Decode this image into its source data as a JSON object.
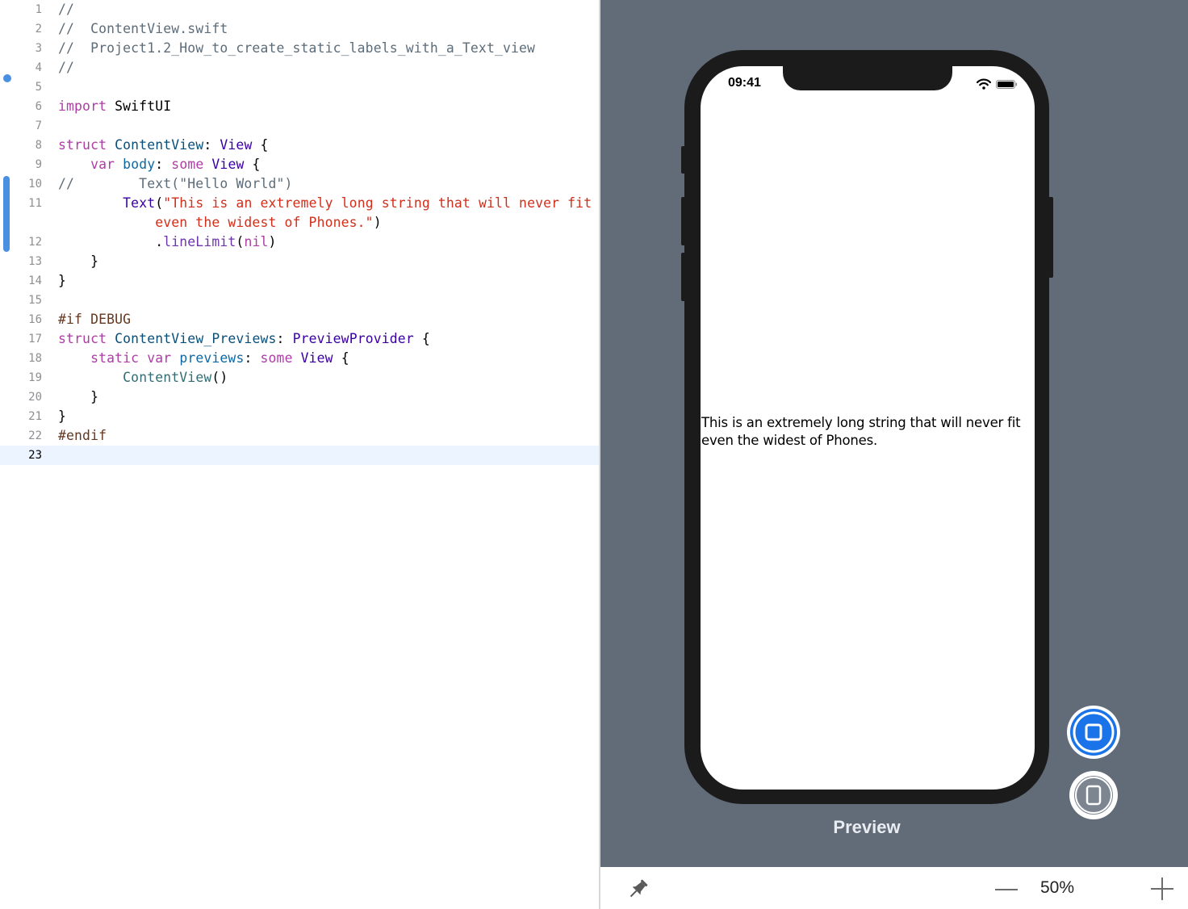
{
  "editor": {
    "current_line": 23,
    "lines": [
      {
        "n": "1",
        "tokens": [
          {
            "c": "comment",
            "t": "//"
          }
        ]
      },
      {
        "n": "2",
        "tokens": [
          {
            "c": "comment",
            "t": "//  ContentView.swift"
          }
        ]
      },
      {
        "n": "3",
        "tokens": [
          {
            "c": "comment",
            "t": "//  Project1.2_How_to_create_static_labels_with_a_Text_view"
          }
        ]
      },
      {
        "n": "4",
        "tokens": [
          {
            "c": "comment",
            "t": "//"
          }
        ]
      },
      {
        "n": "5",
        "tokens": []
      },
      {
        "n": "6",
        "tokens": [
          {
            "c": "kw",
            "t": "import"
          },
          {
            "c": "plain",
            "t": " SwiftUI"
          }
        ]
      },
      {
        "n": "7",
        "tokens": []
      },
      {
        "n": "8",
        "tokens": [
          {
            "c": "kw",
            "t": "struct"
          },
          {
            "c": "plain",
            "t": " "
          },
          {
            "c": "type",
            "t": "ContentView"
          },
          {
            "c": "plain",
            "t": ": "
          },
          {
            "c": "sys",
            "t": "View"
          },
          {
            "c": "plain",
            "t": " {"
          }
        ]
      },
      {
        "n": "9",
        "tokens": [
          {
            "c": "plain",
            "t": "    "
          },
          {
            "c": "kw",
            "t": "var"
          },
          {
            "c": "plain",
            "t": " "
          },
          {
            "c": "prop",
            "t": "body"
          },
          {
            "c": "plain",
            "t": ": "
          },
          {
            "c": "kw",
            "t": "some"
          },
          {
            "c": "plain",
            "t": " "
          },
          {
            "c": "sys",
            "t": "View"
          },
          {
            "c": "plain",
            "t": " {"
          }
        ]
      },
      {
        "n": "10",
        "tokens": [
          {
            "c": "comment",
            "t": "//        Text(\"Hello World\")"
          }
        ]
      },
      {
        "n": "11",
        "tokens": [
          {
            "c": "plain",
            "t": "        "
          },
          {
            "c": "sys",
            "t": "Text"
          },
          {
            "c": "plain",
            "t": "("
          },
          {
            "c": "str",
            "t": "\"This is an extremely long string that will never fit"
          }
        ]
      },
      {
        "n": "",
        "tokens": [
          {
            "c": "str",
            "t": "            even the widest of Phones.\""
          },
          {
            "c": "plain",
            "t": ")"
          }
        ]
      },
      {
        "n": "12",
        "tokens": [
          {
            "c": "plain",
            "t": "            ."
          },
          {
            "c": "meth",
            "t": "lineLimit"
          },
          {
            "c": "plain",
            "t": "("
          },
          {
            "c": "kw",
            "t": "nil"
          },
          {
            "c": "plain",
            "t": ")"
          }
        ]
      },
      {
        "n": "13",
        "tokens": [
          {
            "c": "plain",
            "t": "    }"
          }
        ]
      },
      {
        "n": "14",
        "tokens": [
          {
            "c": "plain",
            "t": "}"
          }
        ]
      },
      {
        "n": "15",
        "tokens": []
      },
      {
        "n": "16",
        "tokens": [
          {
            "c": "pre",
            "t": "#if DEBUG"
          }
        ]
      },
      {
        "n": "17",
        "tokens": [
          {
            "c": "kw",
            "t": "struct"
          },
          {
            "c": "plain",
            "t": " "
          },
          {
            "c": "type",
            "t": "ContentView_Previews"
          },
          {
            "c": "plain",
            "t": ": "
          },
          {
            "c": "sys",
            "t": "PreviewProvider"
          },
          {
            "c": "plain",
            "t": " {"
          }
        ]
      },
      {
        "n": "18",
        "tokens": [
          {
            "c": "plain",
            "t": "    "
          },
          {
            "c": "kw",
            "t": "static"
          },
          {
            "c": "plain",
            "t": " "
          },
          {
            "c": "kw",
            "t": "var"
          },
          {
            "c": "plain",
            "t": " "
          },
          {
            "c": "prop",
            "t": "previews"
          },
          {
            "c": "plain",
            "t": ": "
          },
          {
            "c": "kw",
            "t": "some"
          },
          {
            "c": "plain",
            "t": " "
          },
          {
            "c": "sys",
            "t": "View"
          },
          {
            "c": "plain",
            "t": " {"
          }
        ]
      },
      {
        "n": "19",
        "tokens": [
          {
            "c": "plain",
            "t": "        "
          },
          {
            "c": "call",
            "t": "ContentView"
          },
          {
            "c": "plain",
            "t": "()"
          }
        ]
      },
      {
        "n": "20",
        "tokens": [
          {
            "c": "plain",
            "t": "    }"
          }
        ]
      },
      {
        "n": "21",
        "tokens": [
          {
            "c": "plain",
            "t": "}"
          }
        ]
      },
      {
        "n": "22",
        "tokens": [
          {
            "c": "pre",
            "t": "#endif"
          }
        ]
      },
      {
        "n": "23",
        "tokens": []
      }
    ]
  },
  "preview": {
    "status_time": "09:41",
    "text": "This is an extremely long string that will never fit even the widest of Phones.",
    "label": "Preview"
  },
  "toolbar": {
    "zoom": "50%"
  },
  "icons": {
    "pin": "pin-icon",
    "live": "live-preview-icon",
    "device": "device-icon",
    "wifi": "wifi-icon",
    "battery": "battery-icon",
    "zoom_out": "minus-icon",
    "zoom_in": "plus-icon"
  },
  "colors": {
    "canvas": "#626b78",
    "phone_bezel": "#1b1b1c",
    "live_button": "#1a73e8",
    "current_line": "#ecf5ff",
    "change_marker": "#4a90e2"
  }
}
